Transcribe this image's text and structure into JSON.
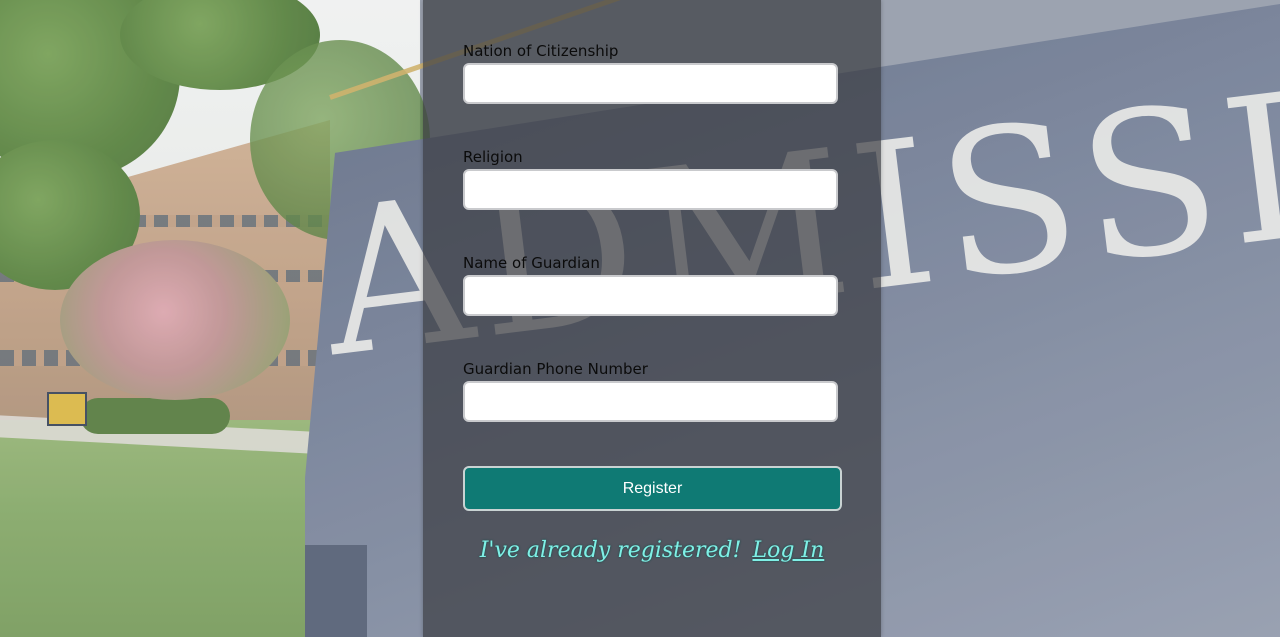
{
  "background": {
    "sign_text": "ADMISSIONS"
  },
  "form": {
    "fields": [
      {
        "label": "Nation of Citizenship",
        "value": "",
        "placeholder": ""
      },
      {
        "label": "Religion",
        "value": "",
        "placeholder": ""
      },
      {
        "label": "Name of Guardian",
        "value": "",
        "placeholder": ""
      },
      {
        "label": "Guardian Phone Number",
        "value": "",
        "placeholder": ""
      }
    ],
    "register_label": "Register",
    "already_registered_text": "I've already registered!",
    "login_link_label": "Log In"
  },
  "colors": {
    "panel_overlay": "#3a3c42",
    "register_button": "#0f7a74",
    "login_text": "#7ff0e6"
  }
}
